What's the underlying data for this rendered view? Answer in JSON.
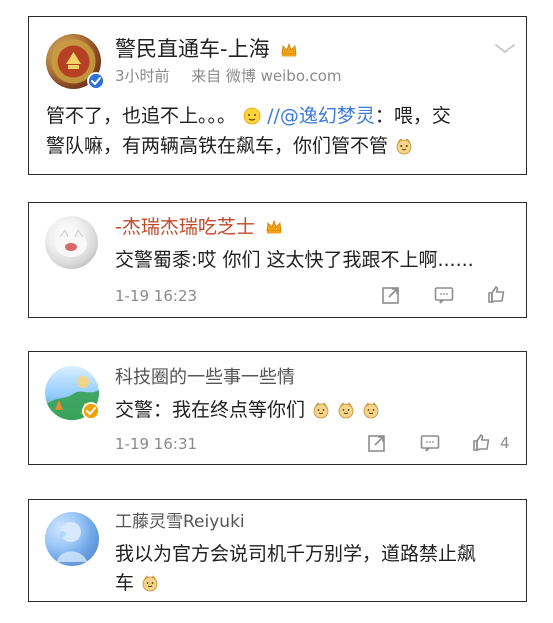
{
  "cards": [
    {
      "user": "警民直通车-上海",
      "time": "3小时前",
      "source": "来自 微博 weibo.com",
      "text_line1_a": "管不了，也追不上。。。",
      "text_line1_mention": "//@逸幻梦灵",
      "text_line1_b": "：喂，交",
      "text_line2": "警队嘛，有两辆高铁在飙车，你们管不管"
    },
    {
      "user": "-杰瑞杰瑞吃芝士",
      "text": "交警蜀黍:哎 你们 这太快了我跟不上啊......",
      "date": "1-19 16:23"
    },
    {
      "user": "科技圈的一些事一些情",
      "text": "交警：我在终点等你们",
      "date": "1-19 16:31",
      "likes": "4"
    },
    {
      "user": "工藤灵雪Reiyuki",
      "text_line1": "我以为官方会说司机千万别学，道路禁止飙",
      "text_line2": "车"
    }
  ],
  "icons": {
    "dropdown": "chevron-down-icon",
    "share": "share-icon",
    "comment": "comment-icon",
    "like": "like-icon",
    "verified": "verified-icon",
    "vip": "vip-crown-icon"
  },
  "colors": {
    "mention": "#3d7ad8",
    "meta": "#8b8b8b",
    "border": "#2b2b2b",
    "text": "#1f1f1f",
    "username": "#555555",
    "username_alt": "#c24a2b"
  }
}
